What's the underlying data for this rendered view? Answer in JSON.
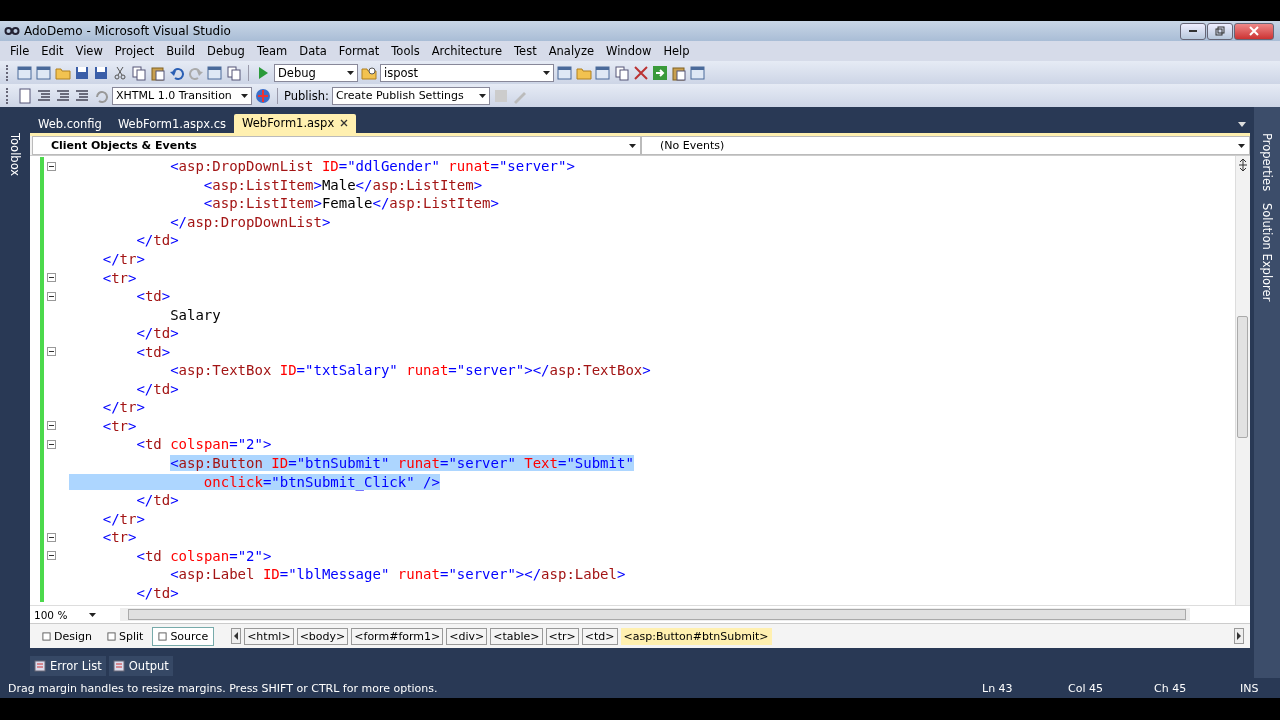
{
  "window": {
    "title": "AdoDemo - Microsoft Visual Studio"
  },
  "menu": [
    "File",
    "Edit",
    "View",
    "Project",
    "Build",
    "Debug",
    "Team",
    "Data",
    "Format",
    "Tools",
    "Architecture",
    "Test",
    "Analyze",
    "Window",
    "Help"
  ],
  "toolbar_1": {
    "configuration": "Debug",
    "find": "ispost"
  },
  "toolbar_2": {
    "doctype": "XHTML 1.0 Transition",
    "publish_label": "Publish:",
    "publish": "Create Publish Settings"
  },
  "left_strip": [
    "Toolbox"
  ],
  "right_strip": [
    "Properties",
    "Solution Explorer"
  ],
  "tabs": [
    {
      "label": "Web.config",
      "selected": false
    },
    {
      "label": "WebForm1.aspx.cs",
      "selected": false
    },
    {
      "label": "WebForm1.aspx",
      "selected": true
    }
  ],
  "navigation": {
    "objects": "Client Objects & Events",
    "events": "(No Events)"
  },
  "code_lines": [
    {
      "collapsible": true,
      "text": "            <asp:DropDownList ID=\"ddlGender\" runat=\"server\">"
    },
    {
      "collapsible": false,
      "text": "                <asp:ListItem>Male</asp:ListItem>"
    },
    {
      "collapsible": false,
      "text": "                <asp:ListItem>Female</asp:ListItem>"
    },
    {
      "collapsible": false,
      "text": "            </asp:DropDownList>"
    },
    {
      "collapsible": false,
      "text": "        </td>"
    },
    {
      "collapsible": false,
      "text": "    </tr>"
    },
    {
      "collapsible": true,
      "text": "    <tr>"
    },
    {
      "collapsible": true,
      "text": "        <td>"
    },
    {
      "collapsible": false,
      "text": "            Salary"
    },
    {
      "collapsible": false,
      "text": "        </td>"
    },
    {
      "collapsible": true,
      "text": "        <td>"
    },
    {
      "collapsible": false,
      "text": "            <asp:TextBox ID=\"txtSalary\" runat=\"server\"></asp:TextBox>"
    },
    {
      "collapsible": false,
      "text": "        </td>"
    },
    {
      "collapsible": false,
      "text": "    </tr>"
    },
    {
      "collapsible": true,
      "text": "    <tr>"
    },
    {
      "collapsible": true,
      "text": "        <td colspan=\"2\">"
    },
    {
      "collapsible": false,
      "selection_from_margin": false,
      "selected_text": "            <asp:Button ID=\"btnSubmit\" runat=\"server\" Text=\"Submit\""
    },
    {
      "collapsible": false,
      "selection_from_margin": true,
      "selected_text": "                onclick=\"btnSubmit_Click\" />"
    },
    {
      "collapsible": false,
      "text": "        </td>"
    },
    {
      "collapsible": false,
      "text": "    </tr>"
    },
    {
      "collapsible": true,
      "text": "    <tr>"
    },
    {
      "collapsible": true,
      "text": "        <td colspan=\"2\">"
    },
    {
      "collapsible": false,
      "text": "            <asp:Label ID=\"lblMessage\" runat=\"server\"></asp:Label>"
    },
    {
      "collapsible": false,
      "text": "        </td>"
    }
  ],
  "zoom": "100 %",
  "view_tabs": [
    {
      "label": "Design",
      "selected": false
    },
    {
      "label": "Split",
      "selected": false
    },
    {
      "label": "Source",
      "selected": true
    }
  ],
  "breadcrumb": [
    {
      "label": "<html>",
      "selected": false
    },
    {
      "label": "<body>",
      "selected": false
    },
    {
      "label": "<form#form1>",
      "selected": false
    },
    {
      "label": "<div>",
      "selected": false
    },
    {
      "label": "<table>",
      "selected": false
    },
    {
      "label": "<tr>",
      "selected": false
    },
    {
      "label": "<td>",
      "selected": false
    },
    {
      "label": "<asp:Button#btnSubmit>",
      "selected": true
    }
  ],
  "tool_windows": [
    "Error List",
    "Output"
  ],
  "status_bar": {
    "message": "Drag margin handles to resize margins. Press SHIFT or CTRL for more options.",
    "line": "Ln 43",
    "column": "Col 45",
    "character": "Ch 45",
    "mode": "INS"
  }
}
